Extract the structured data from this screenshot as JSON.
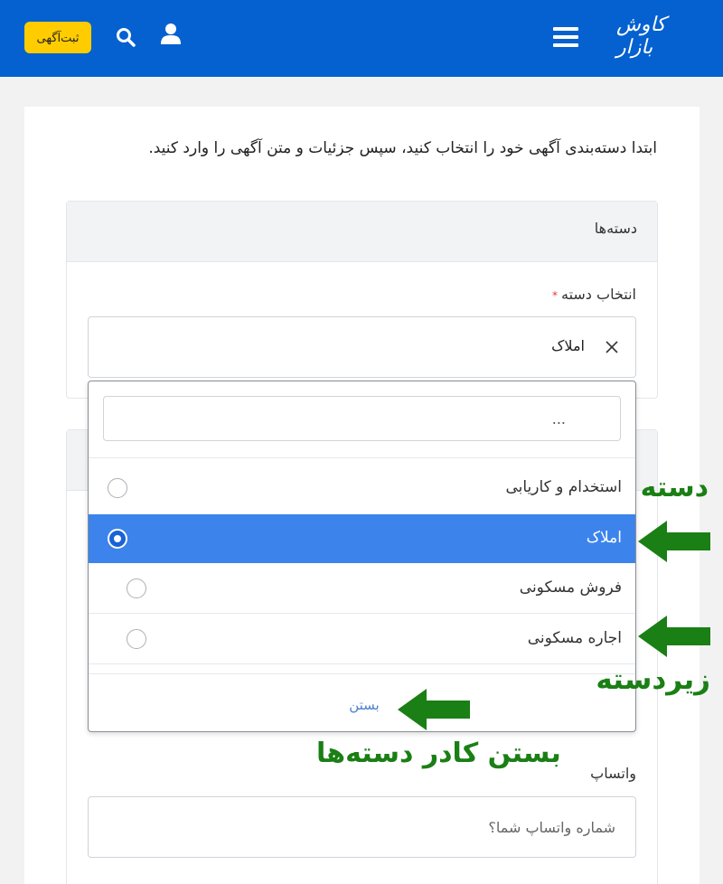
{
  "header": {
    "post_ad_label": "ثبت‌آگهی",
    "logo_text": "کاوش بازار",
    "brand_color": "#0461cf",
    "accent_color": "#ffcc00"
  },
  "intro_text": "ابتدا دسته‌بندی آگهی خود را انتخاب کنید، سپس جزئیات و متن آگهی را وارد کنید.",
  "categories_panel": {
    "title": "دسته‌ها",
    "field_label": "انتخاب دسته",
    "required_mark": "*",
    "selected_value": "املاک"
  },
  "dropdown": {
    "search_placeholder": "...",
    "items": [
      {
        "label": "استخدام و کاریابی",
        "selected": false
      },
      {
        "label": "املاک",
        "selected": true
      },
      {
        "label": "فروش مسکونی",
        "selected": false
      },
      {
        "label": "اجاره مسکونی",
        "selected": false
      }
    ],
    "close_label": "بستن"
  },
  "annotations": {
    "category": "دسته",
    "subcategory": "زیردسته",
    "close_hint": "بستن کادر دسته‌ها",
    "color": "#1a7f14"
  },
  "whatsapp": {
    "label": "واتساپ",
    "placeholder": "شماره واتساپ شما؟"
  }
}
